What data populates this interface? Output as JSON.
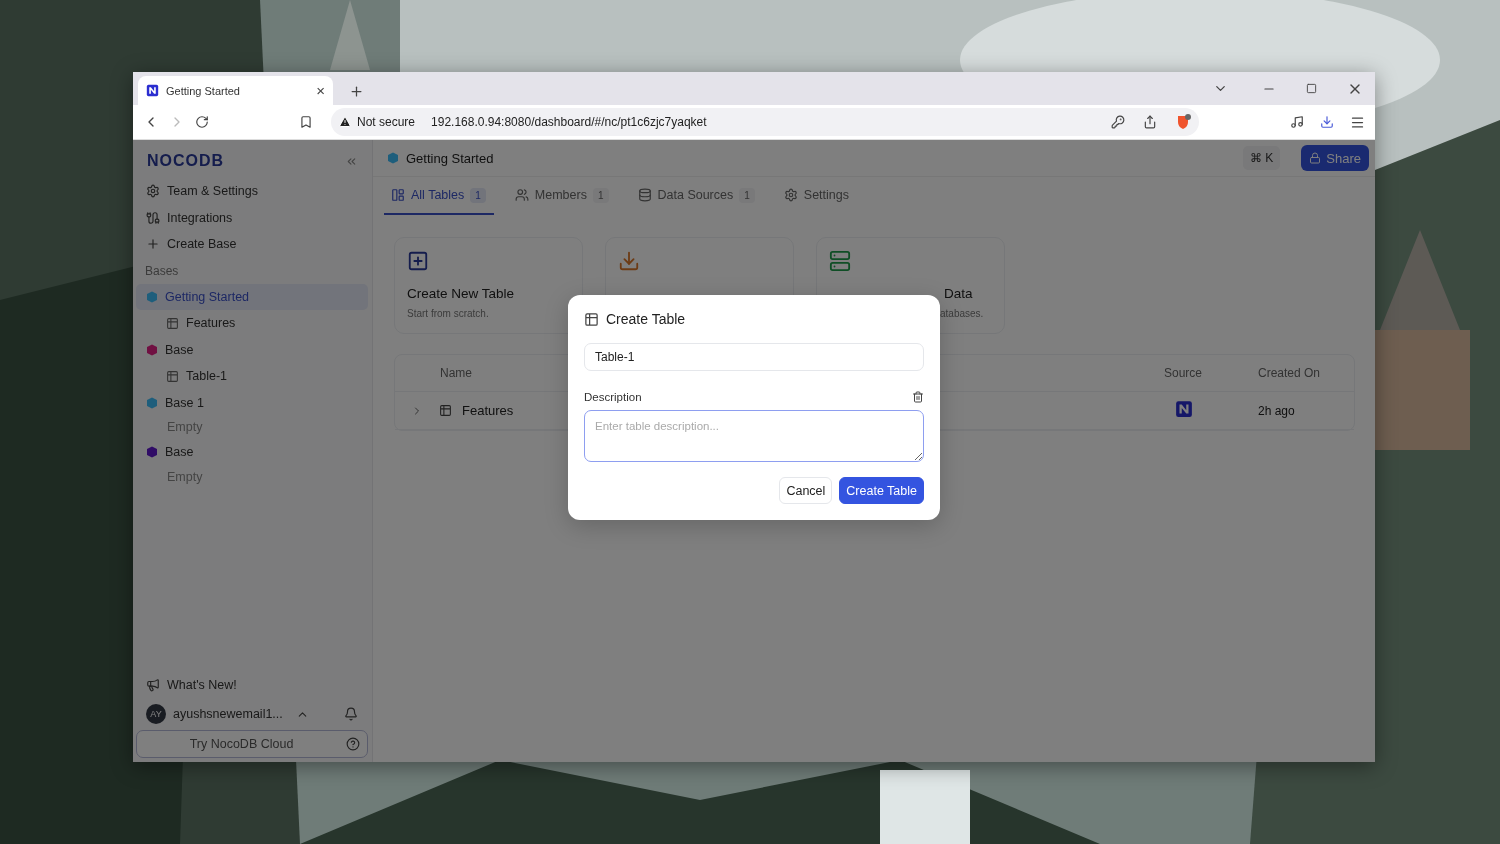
{
  "browser": {
    "tab": {
      "title": "Getting Started",
      "close": "×"
    },
    "address": {
      "security": "Not secure",
      "url": "192.168.0.94:8080/dashboard/#/nc/pt1c6zjc7yaqket"
    }
  },
  "sidebar": {
    "logo": "NOCODB",
    "nav": [
      {
        "label": "Team & Settings",
        "kind": "settings"
      },
      {
        "label": "Integrations",
        "kind": "integrations"
      },
      {
        "label": "Create Base",
        "kind": "create"
      }
    ],
    "section": "Bases",
    "bases": [
      {
        "name": "Getting Started",
        "color": "#1e5e7c",
        "selected": true,
        "children": [
          {
            "label": "Features",
            "kind": "table"
          }
        ]
      },
      {
        "name": "Base",
        "color": "#701042",
        "selected": false,
        "children": [
          {
            "label": "Table-1",
            "kind": "table"
          }
        ]
      },
      {
        "name": "Base 1",
        "color": "#1e5e7c",
        "selected": false,
        "children": [
          {
            "label": "Empty",
            "kind": "empty"
          }
        ]
      },
      {
        "name": "Base",
        "color": "#300c66",
        "selected": false,
        "children": [
          {
            "label": "Empty",
            "kind": "empty"
          }
        ]
      }
    ],
    "whats_new": "What's New!",
    "user": {
      "initials": "AY",
      "name": "ayushsnewemail1..."
    },
    "cloud_button": "Try NocoDB Cloud"
  },
  "main": {
    "title": "Getting Started",
    "shortcut": "⌘ K",
    "share": "Share",
    "tabs": [
      {
        "label": "All Tables",
        "count": "1",
        "kind": "tables",
        "selected": true
      },
      {
        "label": "Members",
        "count": "1",
        "kind": "members",
        "selected": false
      },
      {
        "label": "Data Sources",
        "count": "1",
        "kind": "sources",
        "selected": false
      },
      {
        "label": "Settings",
        "kind": "settings",
        "selected": false
      }
    ],
    "cards": [
      {
        "title": "Create New Table",
        "description": "Start from scratch.",
        "kind": "create"
      },
      {
        "kind": "import"
      },
      {
        "title": "Data",
        "description": "atabases.",
        "kind": "connect"
      }
    ],
    "table": {
      "columns": [
        "Name",
        "Source",
        "Created On"
      ],
      "rows": [
        {
          "name": "Features",
          "created": "2h ago"
        }
      ]
    }
  },
  "modal": {
    "title": "Create Table",
    "name_value": "Table-1",
    "description_label": "Description",
    "description_placeholder": "Enter table description...",
    "buttons": [
      {
        "label": "Cancel",
        "kind": "secondary"
      },
      {
        "label": "Create Table",
        "kind": "primary"
      }
    ]
  }
}
